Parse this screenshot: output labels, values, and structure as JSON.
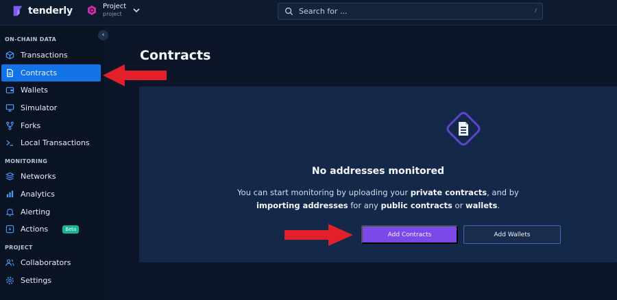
{
  "brand": {
    "name": "tenderly"
  },
  "project": {
    "name": "Project",
    "slug": "project"
  },
  "search": {
    "placeholder": "Search for ...",
    "shortcut": "/"
  },
  "sidebar": {
    "sections": [
      {
        "label": "ON-CHAIN DATA"
      },
      {
        "label": "MONITORING"
      },
      {
        "label": "PROJECT"
      }
    ],
    "items": [
      {
        "label": "Transactions",
        "icon": "cube-icon"
      },
      {
        "label": "Contracts",
        "icon": "document-icon",
        "active": true
      },
      {
        "label": "Wallets",
        "icon": "wallet-icon"
      },
      {
        "label": "Simulator",
        "icon": "monitor-icon"
      },
      {
        "label": "Forks",
        "icon": "fork-icon"
      },
      {
        "label": "Local Transactions",
        "icon": "terminal-icon"
      },
      {
        "label": "Networks",
        "icon": "layers-icon"
      },
      {
        "label": "Analytics",
        "icon": "chart-icon"
      },
      {
        "label": "Alerting",
        "icon": "bell-icon"
      },
      {
        "label": "Actions",
        "icon": "lightning-icon",
        "badge": "Beta"
      },
      {
        "label": "Collaborators",
        "icon": "users-icon"
      },
      {
        "label": "Settings",
        "icon": "gear-icon"
      }
    ]
  },
  "main": {
    "title": "Contracts",
    "empty_state": {
      "title": "No addresses monitored",
      "text_1": "You can start monitoring by uploading your ",
      "bold_1": "private contracts",
      "text_2": ", and by ",
      "bold_2": "importing addresses",
      "text_3": " for any ",
      "bold_3": "public contracts",
      "text_4": " or ",
      "bold_4": "wallets",
      "text_5": ".",
      "primary_button": "Add Contracts",
      "secondary_button": "Add Wallets"
    }
  },
  "colors": {
    "background": "#0c1628",
    "sidebar": "#0a1322",
    "active_item": "#1273e6",
    "card": "#14294a",
    "primary_button": "#7b49e8",
    "beta_badge": "#19b598",
    "annotation_arrow": "#e3202a"
  }
}
